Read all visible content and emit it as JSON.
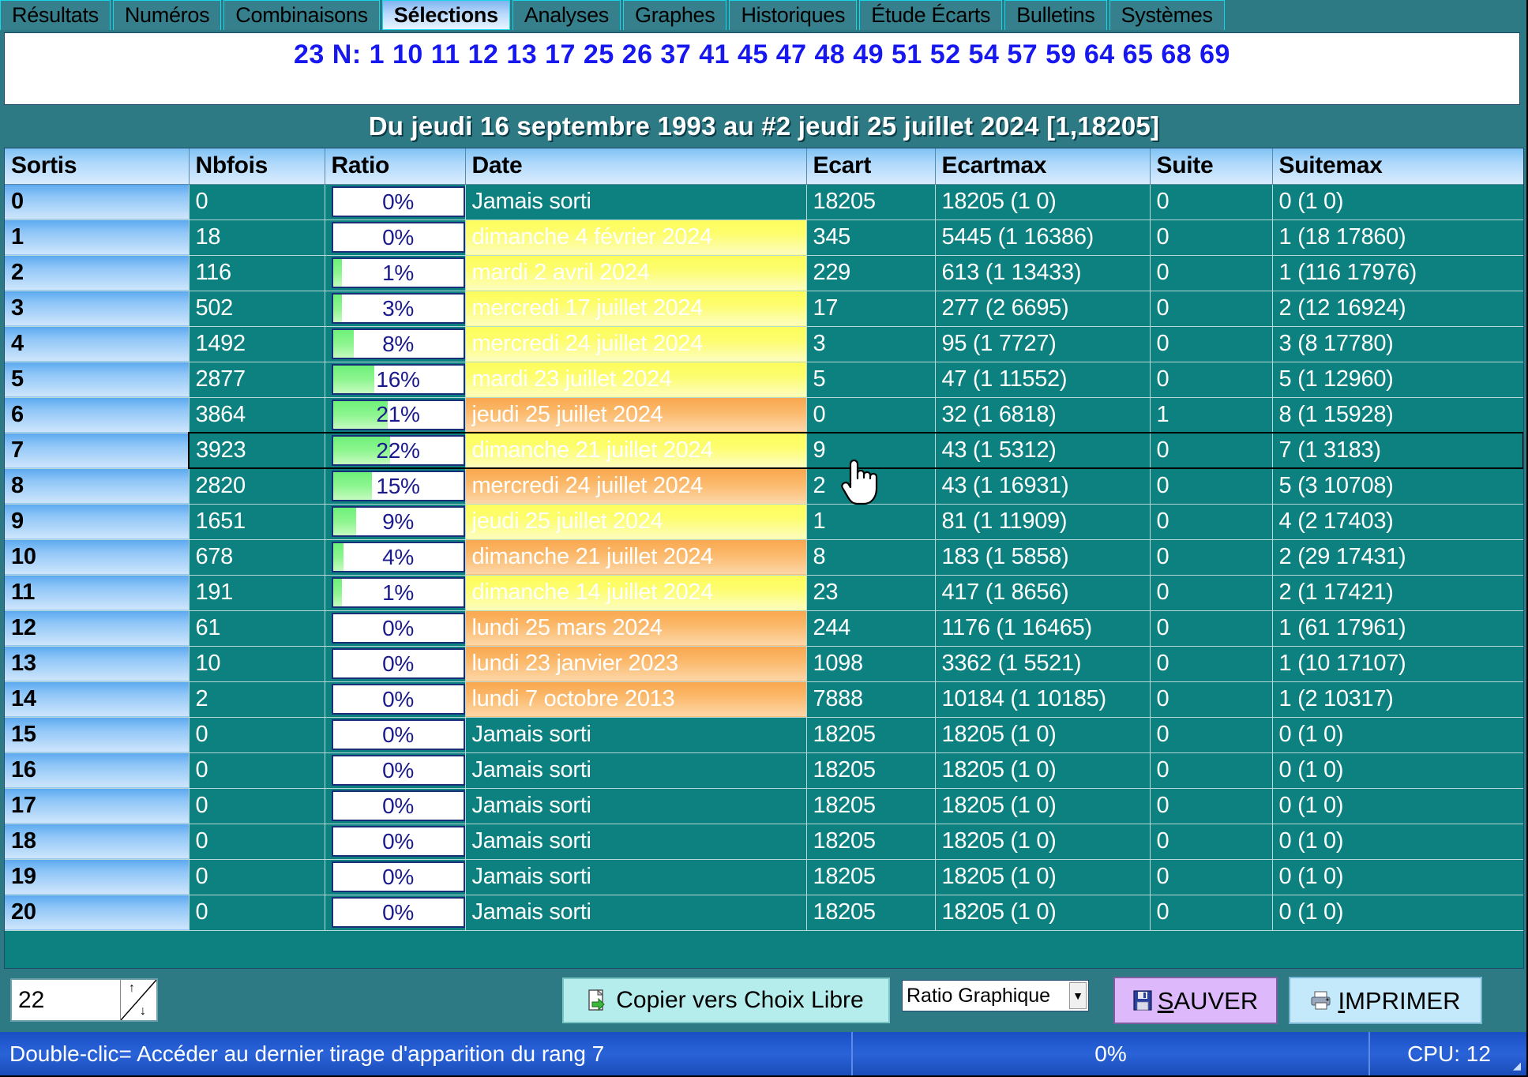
{
  "tabs": [
    {
      "label": "Résultats",
      "active": false
    },
    {
      "label": "Numéros",
      "active": false
    },
    {
      "label": "Combinaisons",
      "active": false
    },
    {
      "label": "Sélections",
      "active": true
    },
    {
      "label": "Analyses",
      "active": false
    },
    {
      "label": "Graphes",
      "active": false
    },
    {
      "label": "Historiques",
      "active": false
    },
    {
      "label": "Étude Écarts",
      "active": false
    },
    {
      "label": "Bulletins",
      "active": false
    },
    {
      "label": "Systèmes",
      "active": false
    }
  ],
  "selection": {
    "count_label": "23 N:",
    "numbers": [
      1,
      10,
      11,
      12,
      13,
      17,
      25,
      26,
      37,
      41,
      45,
      47,
      48,
      49,
      51,
      52,
      54,
      57,
      59,
      64,
      65,
      68,
      69
    ],
    "line": "23 N:  1 10 11 12 13 17 25 26 37 41 45 47 48 49 51 52 54 57 59 64 65 68 69"
  },
  "title": "Du jeudi 16 septembre 1993 au #2 jeudi 25 juillet 2024  [1,18205]",
  "table": {
    "columns": [
      "Sortis",
      "Nbfois",
      "Ratio",
      "Date",
      "Ecart",
      "Ecartmax",
      "Suite",
      "Suitemax"
    ],
    "rows": [
      {
        "sortis": "0",
        "nbfois": "0",
        "ratio": "0%",
        "ratio_pct": 0,
        "date": "Jamais sorti",
        "date_style": "none",
        "ecart": "18205",
        "ecartmax": "18205  (1 0)",
        "suite": "0",
        "suitemax": "0  (1 0)",
        "selected": false
      },
      {
        "sortis": "1",
        "nbfois": "18",
        "ratio": "0%",
        "ratio_pct": 0,
        "date": "dimanche 4 février 2024",
        "date_style": "yellow",
        "ecart": "345",
        "ecartmax": "5445  (1 16386)",
        "suite": "0",
        "suitemax": "1  (18 17860)",
        "selected": false
      },
      {
        "sortis": "2",
        "nbfois": "116",
        "ratio": "1%",
        "ratio_pct": 1,
        "date": "mardi 2 avril 2024",
        "date_style": "yellow",
        "ecart": "229",
        "ecartmax": "613  (1 13433)",
        "suite": "0",
        "suitemax": "1  (116 17976)",
        "selected": false
      },
      {
        "sortis": "3",
        "nbfois": "502",
        "ratio": "3%",
        "ratio_pct": 3,
        "date": "mercredi 17 juillet 2024",
        "date_style": "yellow",
        "ecart": "17",
        "ecartmax": "277  (2 6695)",
        "suite": "0",
        "suitemax": "2  (12 16924)",
        "selected": false
      },
      {
        "sortis": "4",
        "nbfois": "1492",
        "ratio": "8%",
        "ratio_pct": 8,
        "date": "mercredi 24 juillet 2024",
        "date_style": "yellow",
        "ecart": "3",
        "ecartmax": "95  (1 7727)",
        "suite": "0",
        "suitemax": "3  (8 17780)",
        "selected": false
      },
      {
        "sortis": "5",
        "nbfois": "2877",
        "ratio": "16%",
        "ratio_pct": 16,
        "date": "mardi 23 juillet 2024",
        "date_style": "yellow",
        "ecart": "5",
        "ecartmax": "47  (1 11552)",
        "suite": "0",
        "suitemax": "5  (1 12960)",
        "selected": false
      },
      {
        "sortis": "6",
        "nbfois": "3864",
        "ratio": "21%",
        "ratio_pct": 21,
        "date": "jeudi 25 juillet 2024",
        "date_style": "orange",
        "ecart": "0",
        "ecartmax": "32  (1 6818)",
        "suite": "1",
        "suitemax": "8  (1 15928)",
        "selected": false
      },
      {
        "sortis": "7",
        "nbfois": "3923",
        "ratio": "22%",
        "ratio_pct": 22,
        "date": "dimanche 21 juillet 2024",
        "date_style": "yellow",
        "ecart": "9",
        "ecartmax": "43  (1 5312)",
        "suite": "0",
        "suitemax": "7  (1 3183)",
        "selected": true
      },
      {
        "sortis": "8",
        "nbfois": "2820",
        "ratio": "15%",
        "ratio_pct": 15,
        "date": "mercredi 24 juillet 2024",
        "date_style": "orange",
        "ecart": "2",
        "ecartmax": "43  (1 16931)",
        "suite": "0",
        "suitemax": "5  (3 10708)",
        "selected": false
      },
      {
        "sortis": "9",
        "nbfois": "1651",
        "ratio": "9%",
        "ratio_pct": 9,
        "date": "jeudi 25 juillet 2024",
        "date_style": "yellow",
        "ecart": "1",
        "ecartmax": "81  (1 11909)",
        "suite": "0",
        "suitemax": "4  (2 17403)",
        "selected": false
      },
      {
        "sortis": "10",
        "nbfois": "678",
        "ratio": "4%",
        "ratio_pct": 4,
        "date": "dimanche 21 juillet 2024",
        "date_style": "orange",
        "ecart": "8",
        "ecartmax": "183  (1 5858)",
        "suite": "0",
        "suitemax": "2  (29 17431)",
        "selected": false
      },
      {
        "sortis": "11",
        "nbfois": "191",
        "ratio": "1%",
        "ratio_pct": 1,
        "date": "dimanche 14 juillet 2024",
        "date_style": "yellow",
        "ecart": "23",
        "ecartmax": "417  (1 8656)",
        "suite": "0",
        "suitemax": "2  (1 17421)",
        "selected": false
      },
      {
        "sortis": "12",
        "nbfois": "61",
        "ratio": "0%",
        "ratio_pct": 0,
        "date": "lundi 25 mars 2024",
        "date_style": "orange",
        "ecart": "244",
        "ecartmax": "1176  (1 16465)",
        "suite": "0",
        "suitemax": "1  (61 17961)",
        "selected": false
      },
      {
        "sortis": "13",
        "nbfois": "10",
        "ratio": "0%",
        "ratio_pct": 0,
        "date": "lundi 23 janvier 2023",
        "date_style": "orange",
        "ecart": "1098",
        "ecartmax": "3362  (1 5521)",
        "suite": "0",
        "suitemax": "1  (10 17107)",
        "selected": false
      },
      {
        "sortis": "14",
        "nbfois": "2",
        "ratio": "0%",
        "ratio_pct": 0,
        "date": "lundi 7 octobre 2013",
        "date_style": "orange",
        "ecart": "7888",
        "ecartmax": "10184  (1 10185)",
        "suite": "0",
        "suitemax": "1  (2 10317)",
        "selected": false
      },
      {
        "sortis": "15",
        "nbfois": "0",
        "ratio": "0%",
        "ratio_pct": 0,
        "date": "Jamais sorti",
        "date_style": "none",
        "ecart": "18205",
        "ecartmax": "18205  (1 0)",
        "suite": "0",
        "suitemax": "0  (1 0)",
        "selected": false
      },
      {
        "sortis": "16",
        "nbfois": "0",
        "ratio": "0%",
        "ratio_pct": 0,
        "date": "Jamais sorti",
        "date_style": "none",
        "ecart": "18205",
        "ecartmax": "18205  (1 0)",
        "suite": "0",
        "suitemax": "0  (1 0)",
        "selected": false
      },
      {
        "sortis": "17",
        "nbfois": "0",
        "ratio": "0%",
        "ratio_pct": 0,
        "date": "Jamais sorti",
        "date_style": "none",
        "ecart": "18205",
        "ecartmax": "18205  (1 0)",
        "suite": "0",
        "suitemax": "0  (1 0)",
        "selected": false
      },
      {
        "sortis": "18",
        "nbfois": "0",
        "ratio": "0%",
        "ratio_pct": 0,
        "date": "Jamais sorti",
        "date_style": "none",
        "ecart": "18205",
        "ecartmax": "18205  (1 0)",
        "suite": "0",
        "suitemax": "0  (1 0)",
        "selected": false
      },
      {
        "sortis": "19",
        "nbfois": "0",
        "ratio": "0%",
        "ratio_pct": 0,
        "date": "Jamais sorti",
        "date_style": "none",
        "ecart": "18205",
        "ecartmax": "18205  (1 0)",
        "suite": "0",
        "suitemax": "0  (1 0)",
        "selected": false
      },
      {
        "sortis": "20",
        "nbfois": "0",
        "ratio": "0%",
        "ratio_pct": 0,
        "date": "Jamais sorti",
        "date_style": "none",
        "ecart": "18205",
        "ecartmax": "18205  (1 0)",
        "suite": "0",
        "suitemax": "0  (1 0)",
        "selected": false
      }
    ]
  },
  "toolbar": {
    "spinner_value": "22",
    "copy_label": "Copier vers Choix Libre",
    "ratio_select_value": "Ratio Graphique",
    "sauver_label_pre": "",
    "sauver_label_key": "S",
    "sauver_label_rest": "AUVER",
    "imprimer_label_key": "I",
    "imprimer_label_rest": "MPRIMER"
  },
  "status": {
    "message": "Double-clic= Accéder au dernier tirage d'apparition du rang 7",
    "percent": "0%",
    "cpu": "CPU: 12"
  },
  "colors": {
    "app_bg": "#2d7a85",
    "teal_cell": "#0d8080",
    "header_blue": "#aed8fb",
    "number_blue": "#1717ef",
    "ratio_green": "#6ef07a",
    "date_yellow": "#fdfd5c",
    "date_orange": "#f9a74e",
    "status_blue": "#2a63d8"
  }
}
